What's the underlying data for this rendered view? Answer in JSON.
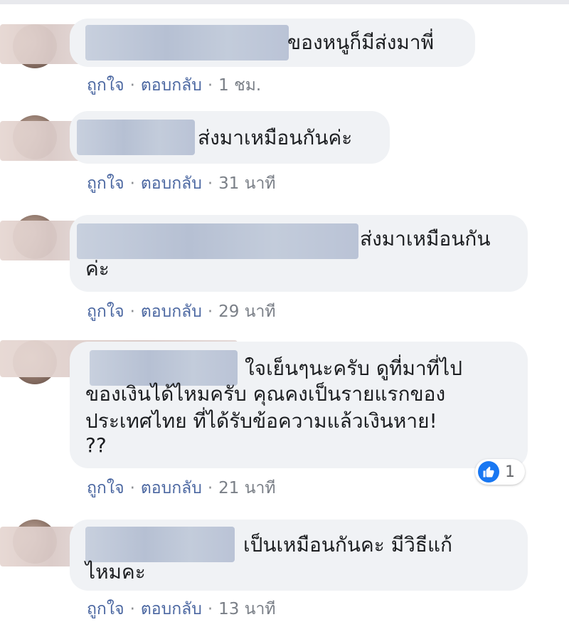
{
  "comments": [
    {
      "text_lines": [
        "ของหนูก็มีส่งมาพี่"
      ],
      "like_label": "ถูกใจ",
      "reply_label": "ตอบกลับ",
      "time": "1 ชม."
    },
    {
      "text_lines": [
        "ส่งมาเหมือนกันค่ะ"
      ],
      "like_label": "ถูกใจ",
      "reply_label": "ตอบกลับ",
      "time": "31 นาที"
    },
    {
      "text_lines": [
        "ส่งมาเหมือนกัน",
        "ค่ะ"
      ],
      "like_label": "ถูกใจ",
      "reply_label": "ตอบกลับ",
      "time": "29 นาที"
    },
    {
      "text_lines": [
        "ใจเย็นๆนะครับ ดูที่มาที่ไป",
        "ของเงินได้ไหมครับ คุณคงเป็นรายแรกของ",
        "ประเทศไทย ที่ได้รับข้อความแล้วเงินหาย!",
        "??"
      ],
      "like_label": "ถูกใจ",
      "reply_label": "ตอบกลับ",
      "time": "21 นาที",
      "reaction_count": "1",
      "reaction_icon": "like-icon"
    },
    {
      "text_lines": [
        "เป็นเหมือนกันคะ มีวิธีแก้",
        "ไหมคะ"
      ],
      "like_label": "ถูกใจ",
      "reply_label": "ตอบกลับ",
      "time": "13 นาที"
    }
  ],
  "separator": "·",
  "colors": {
    "bubble": "#f0f2f5",
    "link": "#4b67a1",
    "like_blue": "#1877f2"
  }
}
